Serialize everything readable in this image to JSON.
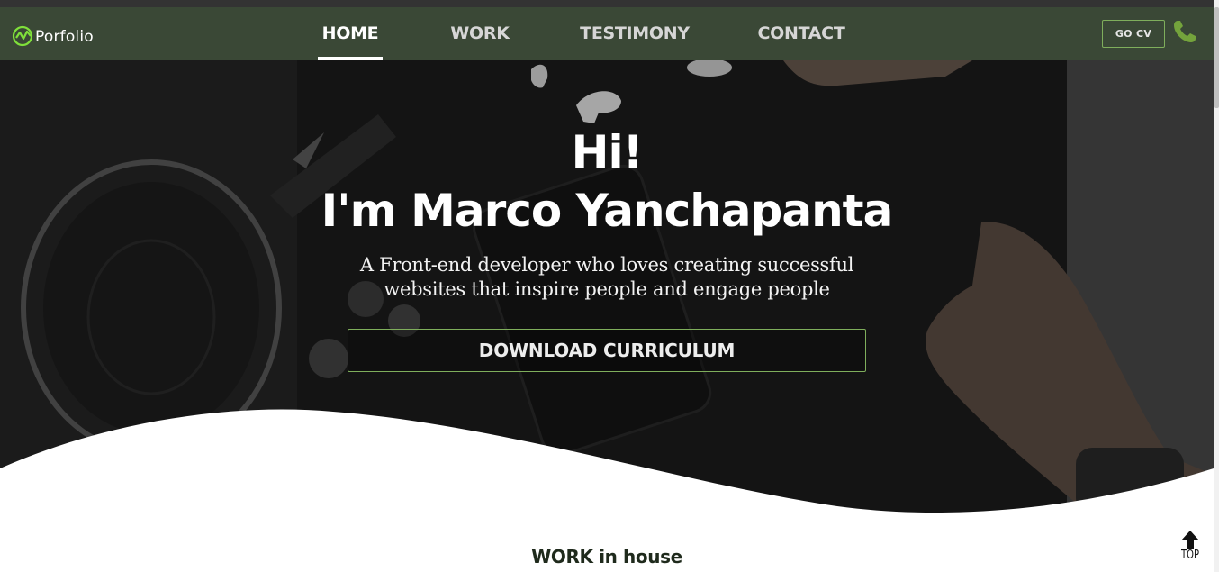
{
  "brand": {
    "logo_text": "Porfolio"
  },
  "nav": {
    "items": [
      {
        "label": "HOME",
        "active": true
      },
      {
        "label": "WORK",
        "active": false
      },
      {
        "label": "TESTIMONY",
        "active": false
      },
      {
        "label": "CONTACT",
        "active": false
      }
    ],
    "cv_button": "GO CV",
    "phone_icon": "phone-icon"
  },
  "hero": {
    "greeting": "Hi!",
    "name": "I'm Marco Yanchapanta",
    "subtitle_lines": [
      "A Front-end developer who loves creating successful",
      "websites that inspire people and engage people"
    ],
    "button_label": "DOWNLOAD CURRICULUM"
  },
  "section": {
    "title": "WORK in house"
  },
  "scroll_top": {
    "label": "TOP",
    "icon": "arrow-up-icon"
  },
  "colors": {
    "navbar": "#3a4836",
    "accent_green": "#7fae5c",
    "phone_green": "#74a33c",
    "hero_overlay": "#262626"
  }
}
